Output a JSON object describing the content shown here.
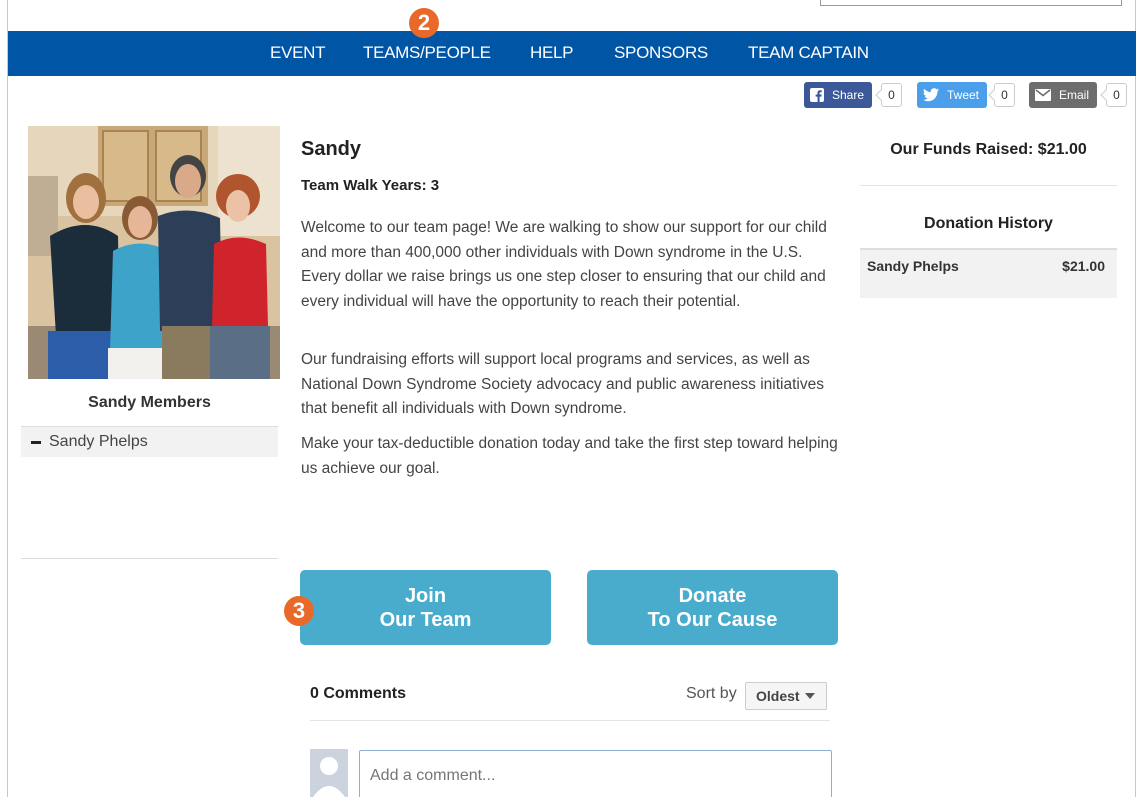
{
  "nav": {
    "items": [
      "EVENT",
      "TEAMS/PEOPLE",
      "HELP",
      "SPONSORS",
      "TEAM CAPTAIN"
    ]
  },
  "markers": {
    "nav_marker": "2",
    "join_marker": "3"
  },
  "social": {
    "facebook": {
      "label": "Share",
      "count": "0",
      "color": "#3b5998"
    },
    "twitter": {
      "label": "Tweet",
      "count": "0",
      "color": "#4a9eea"
    },
    "email": {
      "label": "Email",
      "count": "0",
      "color": "#6d6d6d"
    }
  },
  "team": {
    "name": "Sandy",
    "walk_years": "Team Walk Years: 3",
    "paragraphs": [
      "Welcome to our team page!  We are walking to show our support for our child and more than 400,000 other individuals with Down syndrome in the U.S.  Every dollar we raise brings us one step closer to ensuring that our child and every individual will have the opportunity to reach their potential.",
      "Our fundraising efforts will support local programs and services, as well as National Down Syndrome Society advocacy and public awareness initiatives that benefit all individuals with Down syndrome.",
      "Make your tax-deductible donation today and take the first step toward helping us achieve our goal."
    ]
  },
  "members": {
    "title": "Sandy Members",
    "list": [
      "Sandy Phelps"
    ]
  },
  "actions": {
    "join_line1": "Join",
    "join_line2": "Our Team",
    "donate_line1": "Donate",
    "donate_line2": "To Our Cause"
  },
  "comments": {
    "count_label": "0 Comments",
    "sort_label": "Sort by",
    "sort_value": "Oldest",
    "placeholder": "Add a comment..."
  },
  "funds": {
    "raised_label": "Our Funds Raised: $21.00",
    "history_title": "Donation History",
    "history": [
      {
        "name": "Sandy Phelps",
        "amount": "$21.00"
      }
    ]
  },
  "colors": {
    "nav_bg": "#0055a5",
    "cta_bg": "#4aaccd",
    "marker": "#e8692a"
  }
}
